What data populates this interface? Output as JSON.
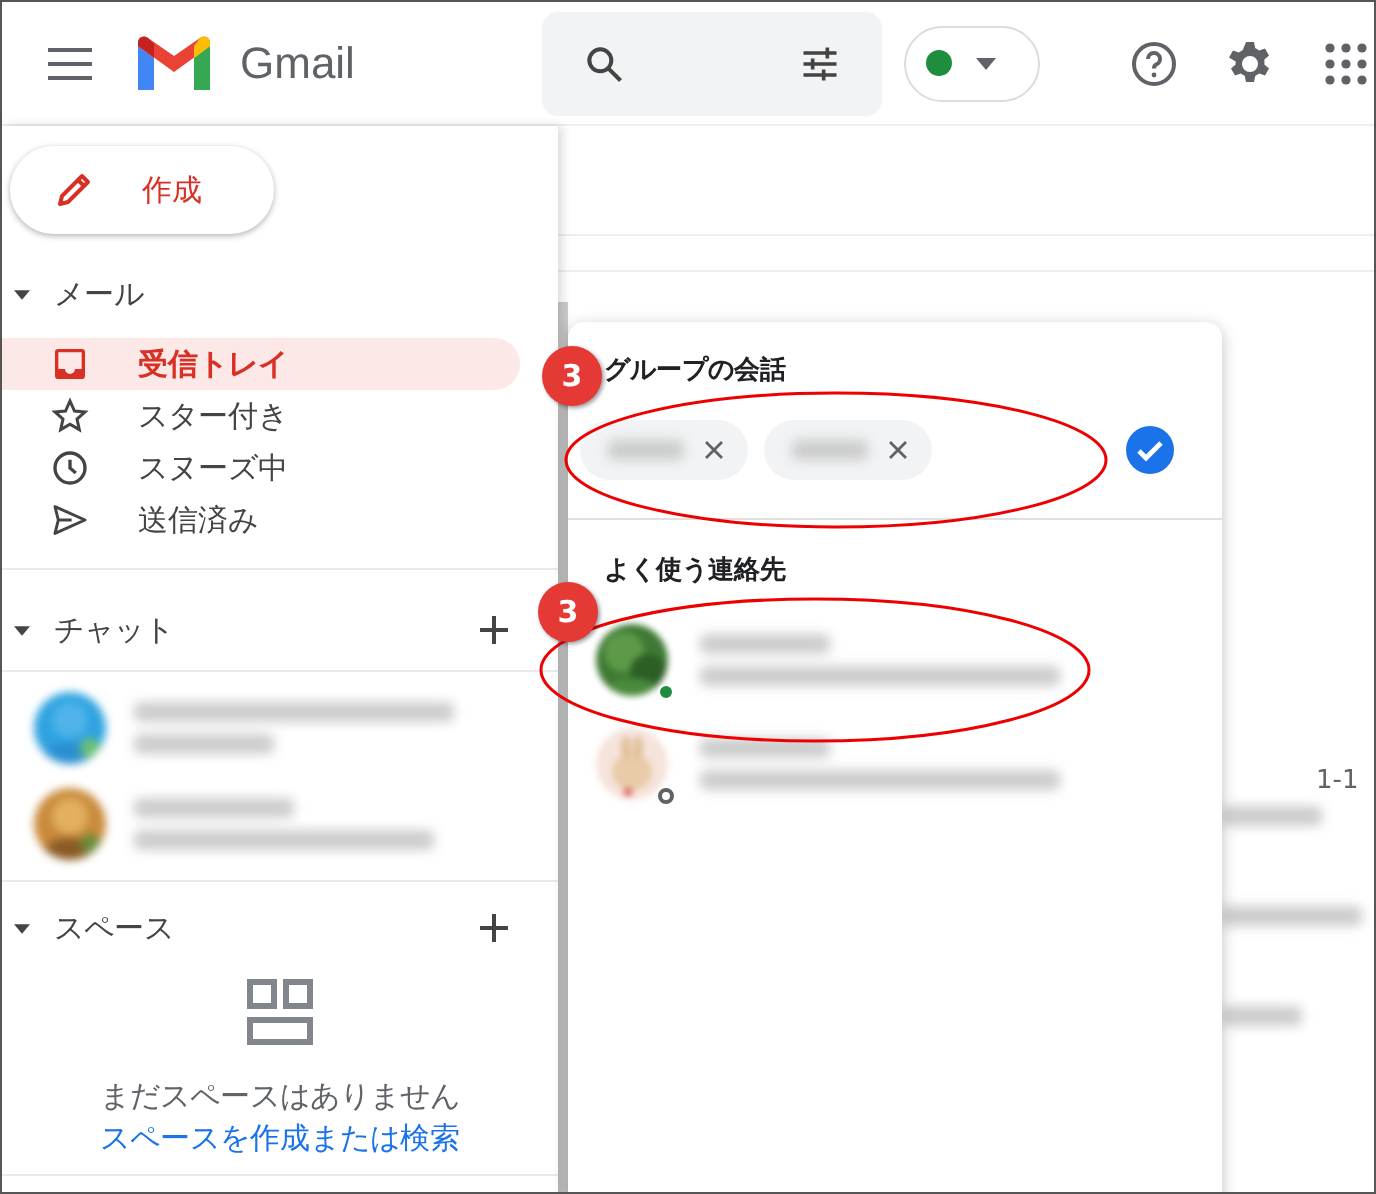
{
  "header": {
    "product": "Gmail",
    "status": {
      "online": true
    }
  },
  "sidebar": {
    "compose": "作成",
    "mail_section": {
      "title": "メール",
      "expanded": true
    },
    "nav_items": [
      {
        "label": "受信トレイ",
        "kind": "inbox",
        "selected": true
      },
      {
        "label": "スター付き",
        "kind": "star",
        "selected": false
      },
      {
        "label": "スヌーズ中",
        "kind": "clock",
        "selected": false
      },
      {
        "label": "送信済み",
        "kind": "send",
        "selected": false
      }
    ],
    "chat_section": {
      "title": "チャット",
      "expanded": true
    },
    "spaces_section": {
      "title": "スペース",
      "expanded": true,
      "empty_text": "まだスペースはありません",
      "link": "スペースを作成または検索"
    }
  },
  "main": {
    "range_label": "1-1"
  },
  "popup": {
    "group_title": "グループの会話",
    "frequent_title": "よく使う連絡先",
    "contacts": [
      {
        "online": true
      },
      {
        "online": false
      }
    ]
  },
  "annotations": [
    {
      "label": "3"
    },
    {
      "label": "3"
    }
  ]
}
